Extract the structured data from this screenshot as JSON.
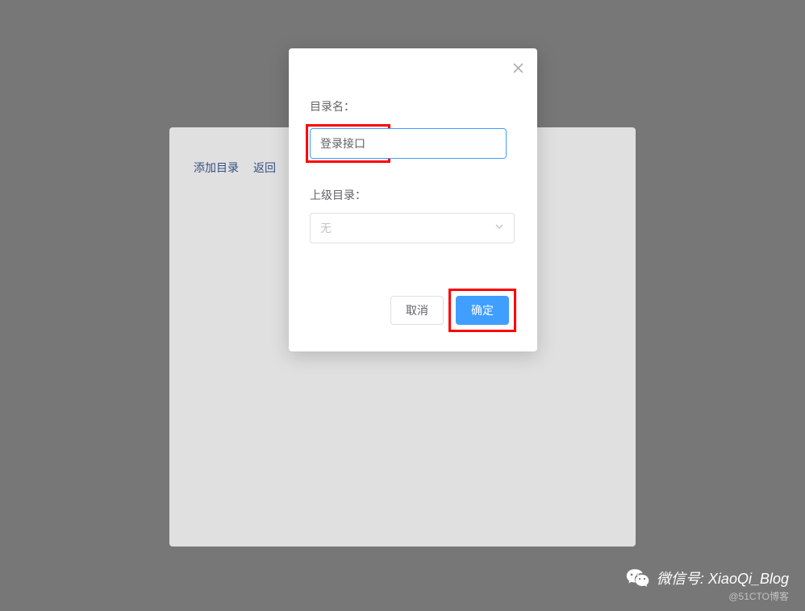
{
  "background": {
    "links": {
      "add_directory": "添加目录",
      "back": "返回"
    }
  },
  "modal": {
    "fields": {
      "directory_name": {
        "label": "目录名：",
        "value": "登录接口"
      },
      "parent_directory": {
        "label": "上级目录：",
        "placeholder": "无"
      }
    },
    "buttons": {
      "cancel": "取消",
      "confirm": "确定"
    }
  },
  "watermark": {
    "text": "微信号: XiaoQi_Blog",
    "sub": "@51CTO博客"
  }
}
